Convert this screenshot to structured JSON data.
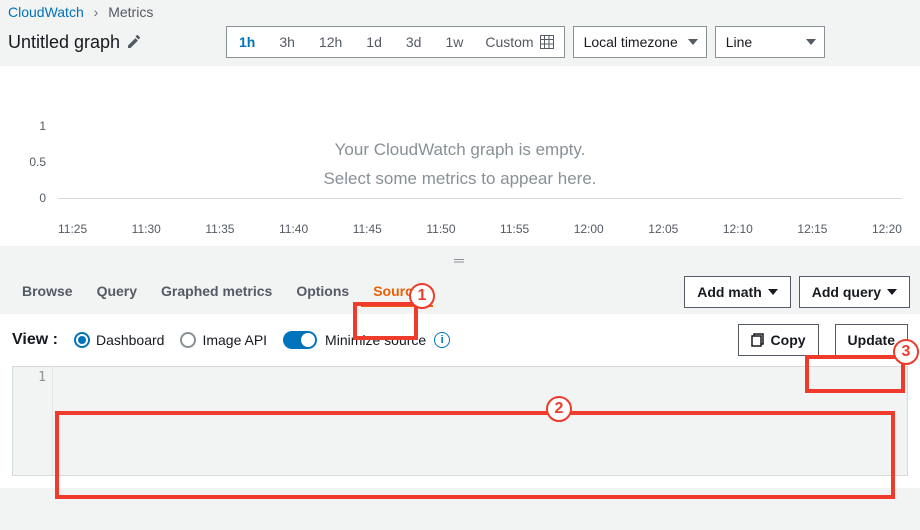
{
  "breadcrumb": {
    "root": "CloudWatch",
    "current": "Metrics"
  },
  "graph": {
    "title": "Untitled graph",
    "empty_line1": "Your CloudWatch graph is empty.",
    "empty_line2": "Select some metrics to appear here."
  },
  "time_ranges": [
    "1h",
    "3h",
    "12h",
    "1d",
    "3d",
    "1w"
  ],
  "time_active": "1h",
  "custom_label": "Custom",
  "timezone": "Local timezone",
  "chart_type": "Line",
  "y_ticks": [
    "1",
    "0.5",
    "0"
  ],
  "x_ticks": [
    "11:25",
    "11:30",
    "11:35",
    "11:40",
    "11:45",
    "11:50",
    "11:55",
    "12:00",
    "12:05",
    "12:10",
    "12:15",
    "12:20"
  ],
  "tabs": [
    "Browse",
    "Query",
    "Graphed metrics",
    "Options",
    "Source"
  ],
  "tab_active": "Source",
  "buttons": {
    "add_math": "Add math",
    "add_query": "Add query",
    "copy": "Copy",
    "update": "Update"
  },
  "view": {
    "label": "View :",
    "dashboard": "Dashboard",
    "image_api": "Image API",
    "minimize": "Minimize source"
  },
  "editor": {
    "line_no": "1"
  },
  "annotations": {
    "n1": "1",
    "n2": "2",
    "n3": "3"
  },
  "chart_data": {
    "type": "line",
    "title": "Untitled graph",
    "series": [],
    "x_ticks": [
      "11:25",
      "11:30",
      "11:35",
      "11:40",
      "11:45",
      "11:50",
      "11:55",
      "12:00",
      "12:05",
      "12:10",
      "12:15",
      "12:20"
    ],
    "ylim": [
      0,
      1
    ],
    "y_ticks": [
      0,
      0.5,
      1
    ],
    "empty_message": "Your CloudWatch graph is empty. Select some metrics to appear here."
  }
}
